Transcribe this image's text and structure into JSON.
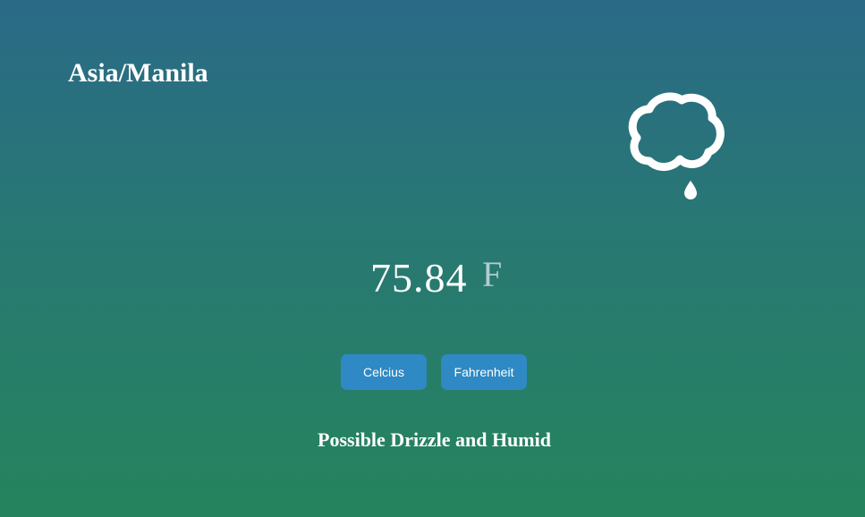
{
  "location": {
    "timezone": "Asia/Manila"
  },
  "weather": {
    "icon": "rain-cloud-icon",
    "temperature": "75.84",
    "unit": "F",
    "summary": "Possible Drizzle and Humid"
  },
  "controls": {
    "celsius_label": "Celcius",
    "fahrenheit_label": "Fahrenheit"
  },
  "colors": {
    "background_top": "#2a6a87",
    "background_bottom": "#25845d",
    "button": "#2e89c4",
    "unit_text": "#b4cdd0"
  }
}
